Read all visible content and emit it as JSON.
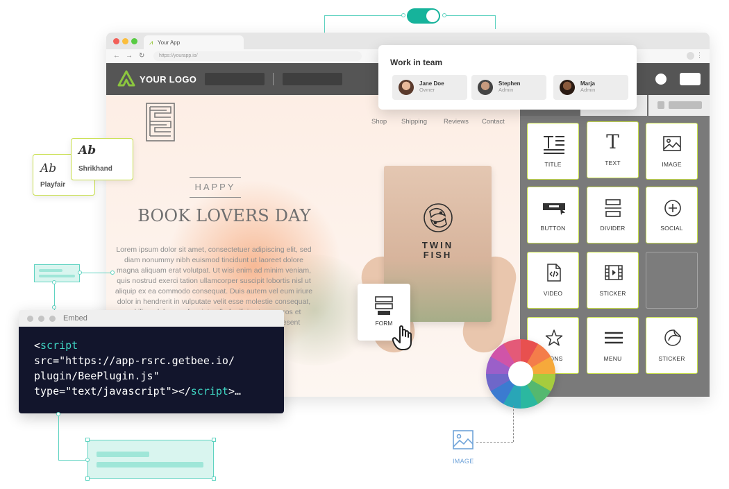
{
  "browser": {
    "tab_title": "Your App",
    "url": "https://yourapp.io/"
  },
  "appbar": {
    "logo_text": "YOUR LOGO"
  },
  "team": {
    "title": "Work in team",
    "members": [
      {
        "name": "Jane Doe",
        "role": "Owner"
      },
      {
        "name": "Stephen",
        "role": "Admin"
      },
      {
        "name": "Marja",
        "role": "Admin"
      }
    ]
  },
  "site": {
    "nav": [
      "Shop",
      "Shipping",
      "Reviews",
      "Contact"
    ],
    "kicker": "HAPPY",
    "headline": "BOOK LOVERS DAY",
    "body": "Lorem ipsum dolor sit amet, consectetuer adipiscing elit, sed diam nonummy nibh euismod tincidunt ut laoreet dolore magna aliquam erat volutpat. Ut wisi enim ad minim veniam, quis nostrud exerci tation ullamcorper suscipit lobortis nisl ut aliquip ex ea commodo consequat. Duis autem vel eum iriure dolor in hendrerit in vulputate velit esse molestie consequat, vel illum dolore eu feugiat nulla facilisis at vero eros et accumsan et iusto odio dignissim qui blandit praesent luptatum zzril delenit",
    "book_title_line1": "TWIN",
    "book_title_line2": "FISH"
  },
  "content_blocks": [
    {
      "label": "TITLE",
      "icon": "title-icon"
    },
    {
      "label": "TEXT",
      "icon": "text-icon"
    },
    {
      "label": "IMAGE",
      "icon": "image-icon"
    },
    {
      "label": "BUTTON",
      "icon": "button-icon"
    },
    {
      "label": "DIVIDER",
      "icon": "divider-icon"
    },
    {
      "label": "SOCIAL",
      "icon": "social-icon"
    },
    {
      "label": "VIDEO",
      "icon": "video-icon"
    },
    {
      "label": "STICKER",
      "icon": "sticker-film-icon"
    },
    {
      "label": "ICONS",
      "icon": "star-icon"
    },
    {
      "label": "MENU",
      "icon": "menu-icon"
    },
    {
      "label": "STICKER",
      "icon": "sticker-icon"
    }
  ],
  "form_tile": {
    "label": "FORM"
  },
  "fonts": [
    {
      "sample": "Ab",
      "name": "Playfair"
    },
    {
      "sample": "Ab",
      "name": "Shrikhand"
    }
  ],
  "embed": {
    "title": "Embed",
    "line1_pre": "<",
    "line1_tag": "script",
    "line2": "src=\"https://app-rsrc.getbee.io/",
    "line3": "plugin/BeePlugin.js\"",
    "line4_pre": "type=\"text/javascript\"></",
    "line4_tag": "script",
    "line4_post": ">…"
  },
  "image_element": {
    "label": "IMAGE"
  },
  "colors": {
    "accent": "#16b39b",
    "lime": "#c7de4a",
    "code_bg": "#12152c",
    "appbar": "#555555"
  }
}
